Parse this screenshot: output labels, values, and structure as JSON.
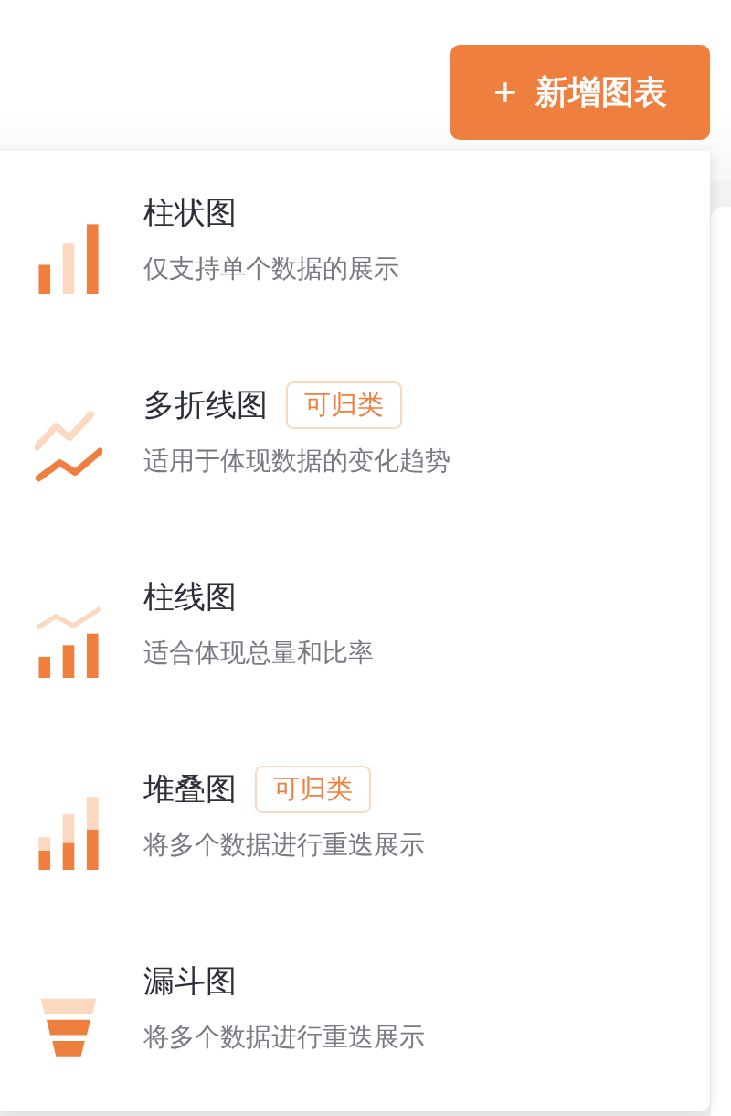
{
  "add_button": {
    "label": "新增图表"
  },
  "chart_types": [
    {
      "kind": "bar",
      "title": "柱状图",
      "description": "仅支持单个数据的展示"
    },
    {
      "kind": "multiline",
      "title": "多折线图",
      "tag": "可归类",
      "description": "适用于体现数据的变化趋势"
    },
    {
      "kind": "barline",
      "title": "柱线图",
      "description": "适合体现总量和比率"
    },
    {
      "kind": "stacked",
      "title": "堆叠图",
      "tag": "可归类",
      "description": "将多个数据进行重迭展示"
    },
    {
      "kind": "funnel",
      "title": "漏斗图",
      "description": "将多个数据进行重迭展示"
    }
  ]
}
